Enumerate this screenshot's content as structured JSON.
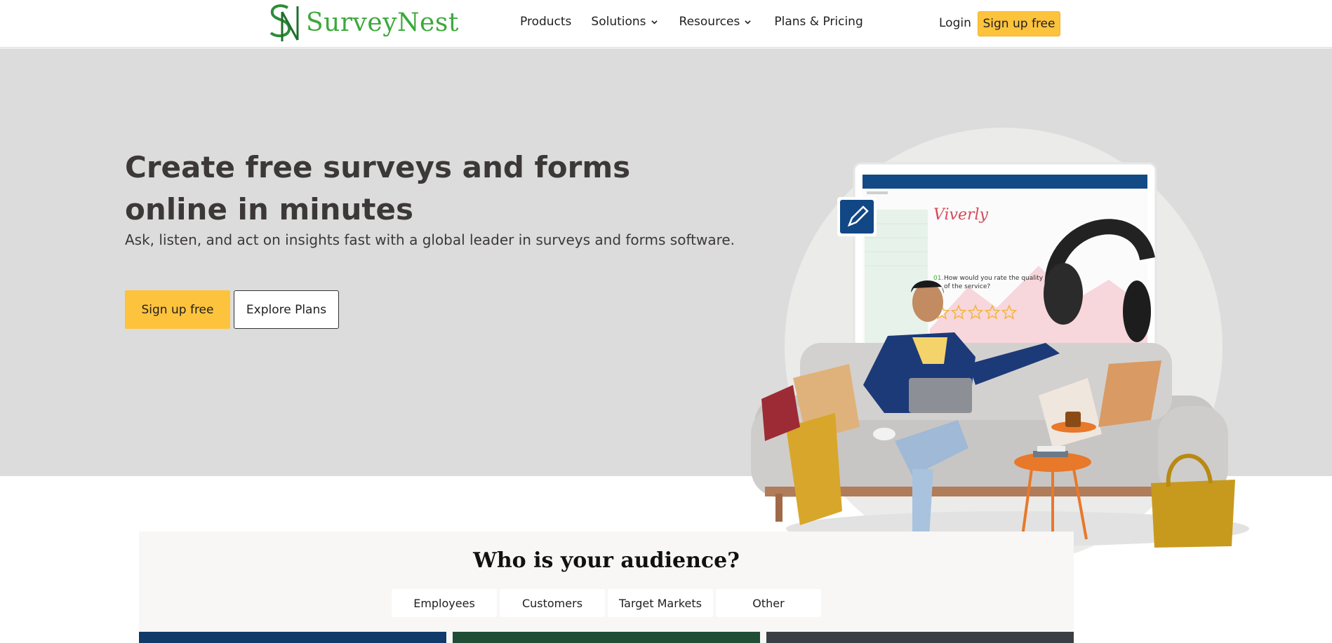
{
  "header": {
    "logo_text": "SurveyNest",
    "nav": {
      "products": "Products",
      "solutions": "Solutions",
      "resources": "Resources",
      "pricing": "Plans & Pricing"
    },
    "login": "Login",
    "signup": "Sign up free"
  },
  "hero": {
    "title": "Create free surveys and forms online in minutes",
    "subtitle": "Ask, listen, and act on insights fast with a global leader in surveys and forms software.",
    "primary_cta": "Sign up free",
    "secondary_cta": "Explore Plans",
    "illustration": {
      "brand": "Viverly",
      "question_number": "01.",
      "question": "How would you rate the quality of the service?",
      "star_count": 5
    }
  },
  "audience": {
    "title": "Who is your audience?",
    "tabs": [
      "Employees",
      "Customers",
      "Target Markets",
      "Other"
    ]
  },
  "colors": {
    "accent": "#fec33d",
    "brand_green": "#3ca93c",
    "hero_bg": "#dcdcdc",
    "heading": "#3d3838"
  }
}
